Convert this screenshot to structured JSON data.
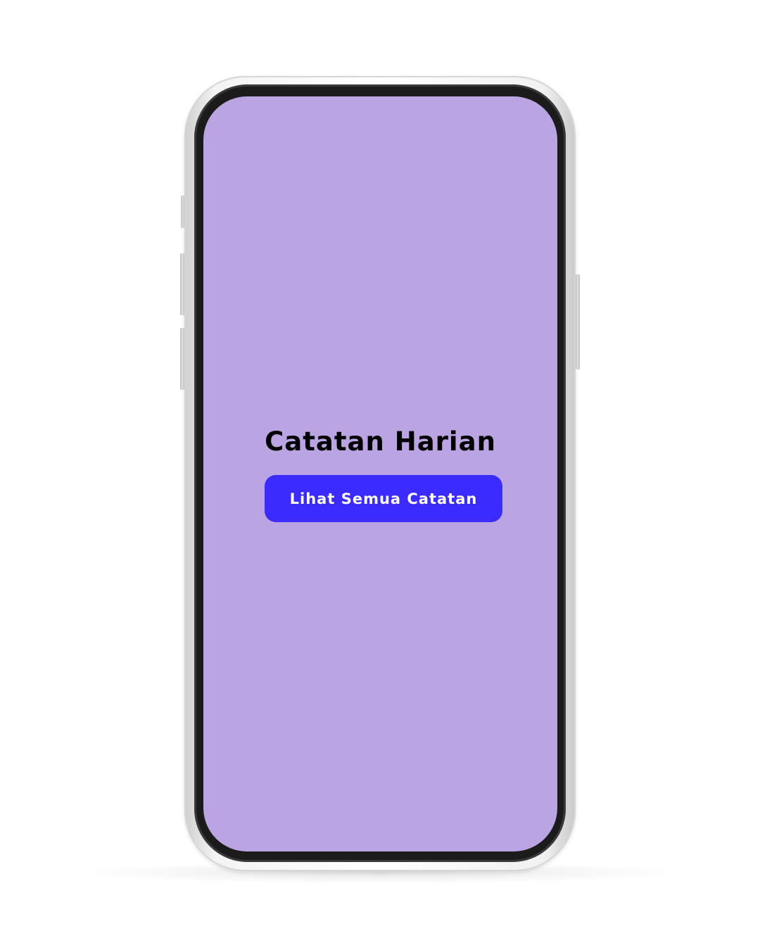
{
  "app": {
    "title": "Catatan Harian"
  },
  "actions": {
    "view_all_label": "Lihat Semua Catatan"
  },
  "colors": {
    "screen_background": "#bba4e2",
    "primary_button": "#3b2bff",
    "button_text": "#ffffff",
    "title_text": "#000000"
  }
}
